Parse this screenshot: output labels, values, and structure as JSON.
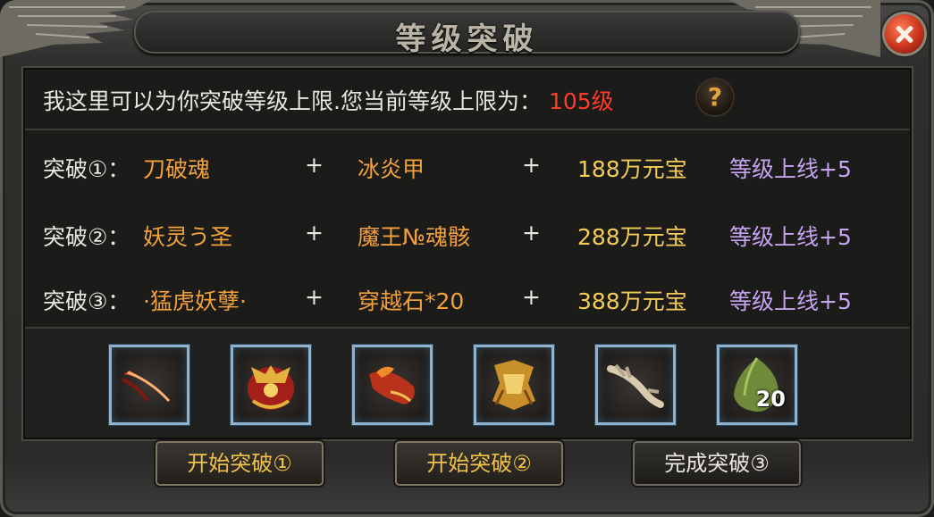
{
  "window": {
    "title": "等级突破"
  },
  "info": {
    "text": "我这里可以为你突破等级上限.您当前等级上限为：",
    "level": "105级",
    "help_symbol": "?"
  },
  "recipes": [
    {
      "label": "突破①：",
      "material1": "刀破魂",
      "plus": "+",
      "material2": "冰炎甲",
      "cost": "188万元宝",
      "bonus": "等级上线+5"
    },
    {
      "label": "突破②：",
      "material1": "妖灵う圣",
      "plus": "+",
      "material2": "魔王№魂骸",
      "cost": "288万元宝",
      "bonus": "等级上线+5"
    },
    {
      "label": "突破③：",
      "material1": "·猛虎妖孽·",
      "plus": "+",
      "material2": "穿越石*20",
      "cost": "388万元宝",
      "bonus": "等级上线+5"
    }
  ],
  "items": [
    {
      "icon": "red-blade-icon"
    },
    {
      "icon": "red-gold-armor-icon"
    },
    {
      "icon": "flame-bracer-icon"
    },
    {
      "icon": "golden-relic-icon"
    },
    {
      "icon": "bone-claw-icon"
    },
    {
      "icon": "green-stone-icon",
      "count": "20"
    }
  ],
  "buttons": [
    {
      "label": "开始突破①"
    },
    {
      "label": "开始突破②"
    },
    {
      "label": "完成突破③"
    }
  ],
  "colors": {
    "level": "#ff3b2a",
    "material": "#f2a03c",
    "cost": "#f4cc58",
    "bonus": "#c5a4f0",
    "frame": "#8fb3cf"
  }
}
